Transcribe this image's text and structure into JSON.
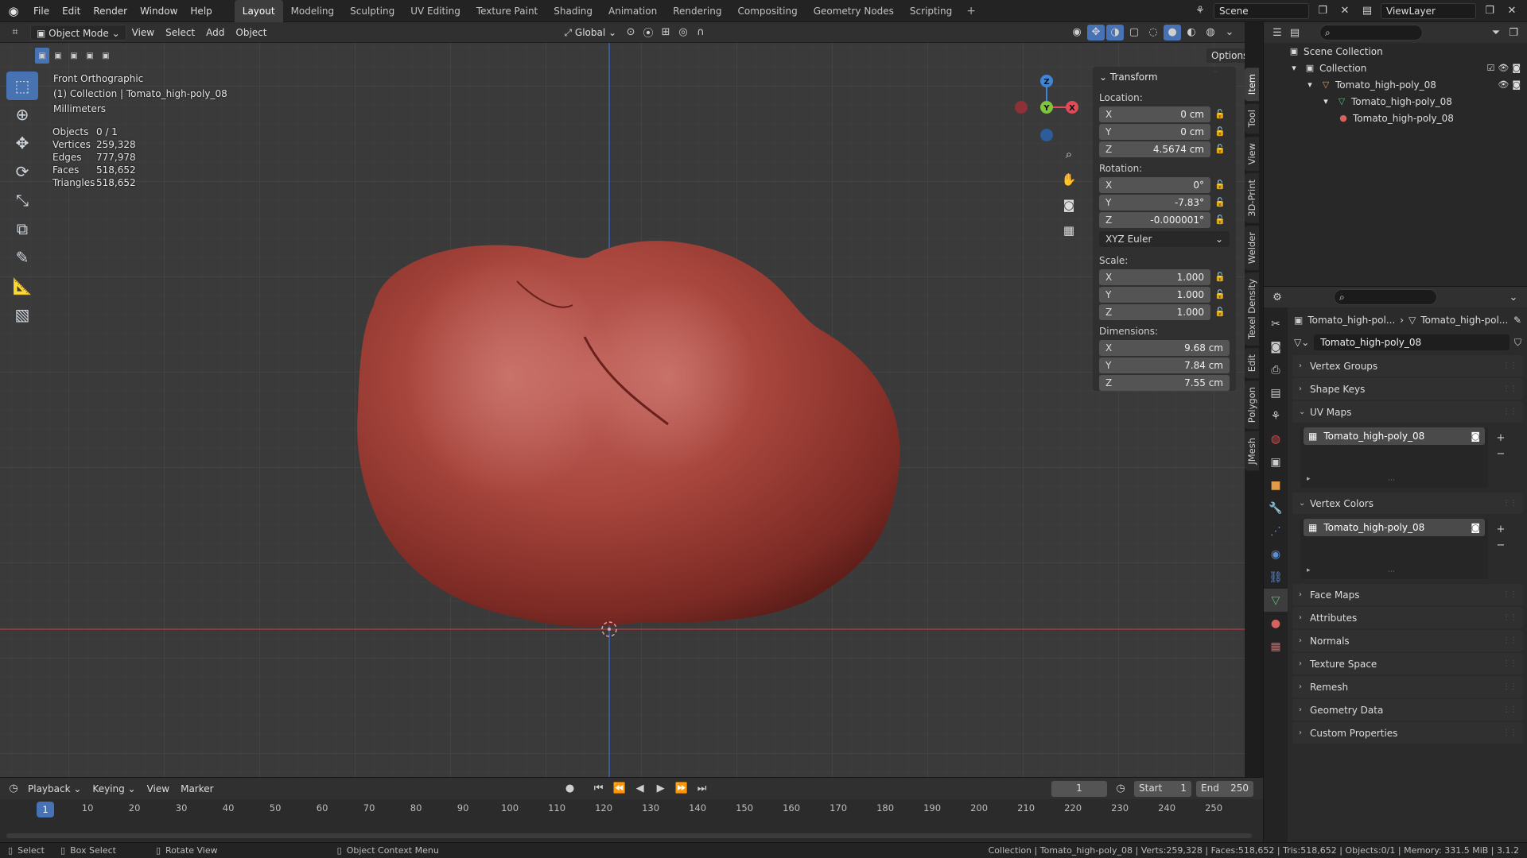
{
  "topbar": {
    "menus": [
      "File",
      "Edit",
      "Render",
      "Window",
      "Help"
    ],
    "workspaces": [
      "Layout",
      "Modeling",
      "Sculpting",
      "UV Editing",
      "Texture Paint",
      "Shading",
      "Animation",
      "Rendering",
      "Compositing",
      "Geometry Nodes",
      "Scripting"
    ],
    "active_workspace": "Layout",
    "scene": "Scene",
    "view_layer": "ViewLayer"
  },
  "viewport_header": {
    "mode": "Object Mode",
    "menus": [
      "View",
      "Select",
      "Add",
      "Object"
    ],
    "orientation": "Global",
    "options": "Options"
  },
  "viewport": {
    "view_name": "Front Orthographic",
    "collection_line": "(1) Collection | Tomato_high-poly_08",
    "units": "Millimeters",
    "stats": [
      {
        "label": "Objects",
        "value": "0 / 1"
      },
      {
        "label": "Vertices",
        "value": "259,328"
      },
      {
        "label": "Edges",
        "value": "777,978"
      },
      {
        "label": "Faces",
        "value": "518,652"
      },
      {
        "label": "Triangles",
        "value": "518,652"
      }
    ],
    "gizmo": {
      "z": "Z",
      "y": "Y",
      "x": "X"
    }
  },
  "transform_panel": {
    "title": "Transform",
    "location_label": "Location:",
    "location": [
      {
        "axis": "X",
        "value": "0 cm"
      },
      {
        "axis": "Y",
        "value": "0 cm"
      },
      {
        "axis": "Z",
        "value": "4.5674 cm"
      }
    ],
    "rotation_label": "Rotation:",
    "rotation": [
      {
        "axis": "X",
        "value": "0°"
      },
      {
        "axis": "Y",
        "value": "-7.83°"
      },
      {
        "axis": "Z",
        "value": "-0.000001°"
      }
    ],
    "rotation_mode": "XYZ Euler",
    "scale_label": "Scale:",
    "scale": [
      {
        "axis": "X",
        "value": "1.000"
      },
      {
        "axis": "Y",
        "value": "1.000"
      },
      {
        "axis": "Z",
        "value": "1.000"
      }
    ],
    "dimensions_label": "Dimensions:",
    "dimensions": [
      {
        "axis": "X",
        "value": "9.68 cm"
      },
      {
        "axis": "Y",
        "value": "7.84 cm"
      },
      {
        "axis": "Z",
        "value": "7.55 cm"
      }
    ]
  },
  "sidebar_tabs": [
    "Item",
    "Tool",
    "View",
    "3D-Print",
    "Welder",
    "Texel Density",
    "Edit",
    "Polygon",
    "JMesh"
  ],
  "outliner": {
    "rows": [
      "Scene Collection",
      "Collection",
      "Tomato_high-poly_08",
      "Tomato_high-poly_08",
      "Tomato_high-poly_08"
    ]
  },
  "properties": {
    "crumb_object": "Tomato_high-pol...",
    "crumb_mesh": "Tomato_high-pol...",
    "mesh_name": "Tomato_high-poly_08",
    "sections": {
      "vertex_groups": "Vertex Groups",
      "shape_keys": "Shape Keys",
      "uv_maps": "UV Maps",
      "vertex_colors": "Vertex Colors",
      "face_maps": "Face Maps",
      "attributes": "Attributes",
      "normals": "Normals",
      "texture_space": "Texture Space",
      "remesh": "Remesh",
      "geometry_data": "Geometry Data",
      "custom_properties": "Custom Properties"
    },
    "uv_item": "Tomato_high-poly_08",
    "vc_item": "Tomato_high-poly_08"
  },
  "timeline": {
    "menus": [
      "Playback",
      "Keying",
      "View",
      "Marker"
    ],
    "current_frame": "1",
    "start_label": "Start",
    "start": "1",
    "end_label": "End",
    "end": "250",
    "ticks": [
      "10",
      "20",
      "30",
      "40",
      "50",
      "60",
      "70",
      "80",
      "90",
      "100",
      "110",
      "120",
      "130",
      "140",
      "150",
      "160",
      "170",
      "180",
      "190",
      "200",
      "210",
      "220",
      "230",
      "240",
      "250"
    ]
  },
  "statusbar": {
    "select": "Select",
    "box_select": "Box Select",
    "rotate_view": "Rotate View",
    "context_menu": "Object Context Menu",
    "info": "Collection | Tomato_high-poly_08 | Verts:259,328 | Faces:518,652 | Tris:518,652 | Objects:0/1 | Memory: 331.5 MiB | 3.1.2"
  },
  "colors": {
    "accent": "#4772b3",
    "tomato": "#a5443b",
    "x_axis": "#e34a56",
    "y_axis": "#7fc63a",
    "z_axis": "#3f86d6"
  }
}
